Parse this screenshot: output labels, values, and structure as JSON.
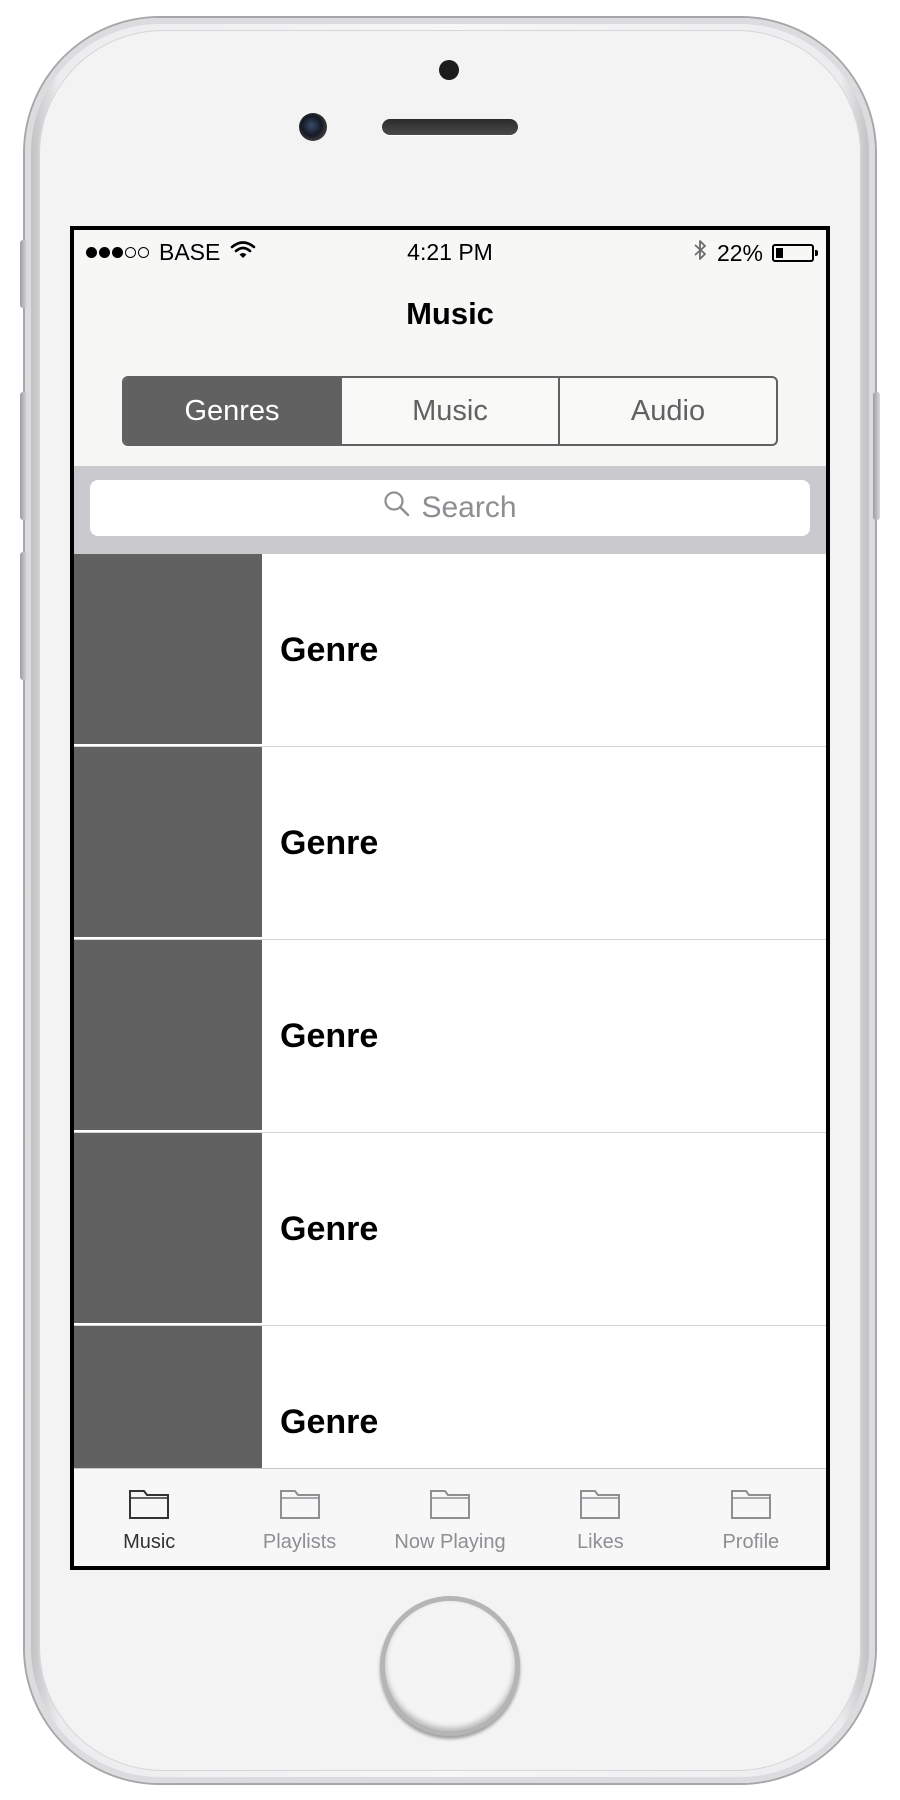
{
  "status_bar": {
    "carrier": "BASE",
    "signal_bars_filled": 3,
    "signal_bars_total": 5,
    "time": "4:21 PM",
    "battery_percent_label": "22%",
    "battery_level": 0.22,
    "icons": [
      "wifi-icon",
      "bluetooth-icon",
      "battery-icon"
    ]
  },
  "nav": {
    "title": "Music"
  },
  "segmented_control": {
    "segments": [
      {
        "label": "Genres",
        "active": true
      },
      {
        "label": "Music",
        "active": false
      },
      {
        "label": "Audio",
        "active": false
      }
    ]
  },
  "search": {
    "placeholder": "Search",
    "icon": "search-icon"
  },
  "genres": [
    {
      "label": "Genre"
    },
    {
      "label": "Genre"
    },
    {
      "label": "Genre"
    },
    {
      "label": "Genre"
    },
    {
      "label": "Genre"
    }
  ],
  "tab_bar": {
    "items": [
      {
        "label": "Music",
        "icon": "folder-icon",
        "active": true
      },
      {
        "label": "Playlists",
        "icon": "folder-icon",
        "active": false
      },
      {
        "label": "Now Playing",
        "icon": "folder-icon",
        "active": false
      },
      {
        "label": "Likes",
        "icon": "folder-icon",
        "active": false
      },
      {
        "label": "Profile",
        "icon": "folder-icon",
        "active": false
      }
    ]
  },
  "colors": {
    "segment_active": "#616161",
    "thumbnail": "#616161",
    "search_background": "#c9c9ce",
    "tab_active": "#333333",
    "tab_inactive": "#8e8e93"
  }
}
